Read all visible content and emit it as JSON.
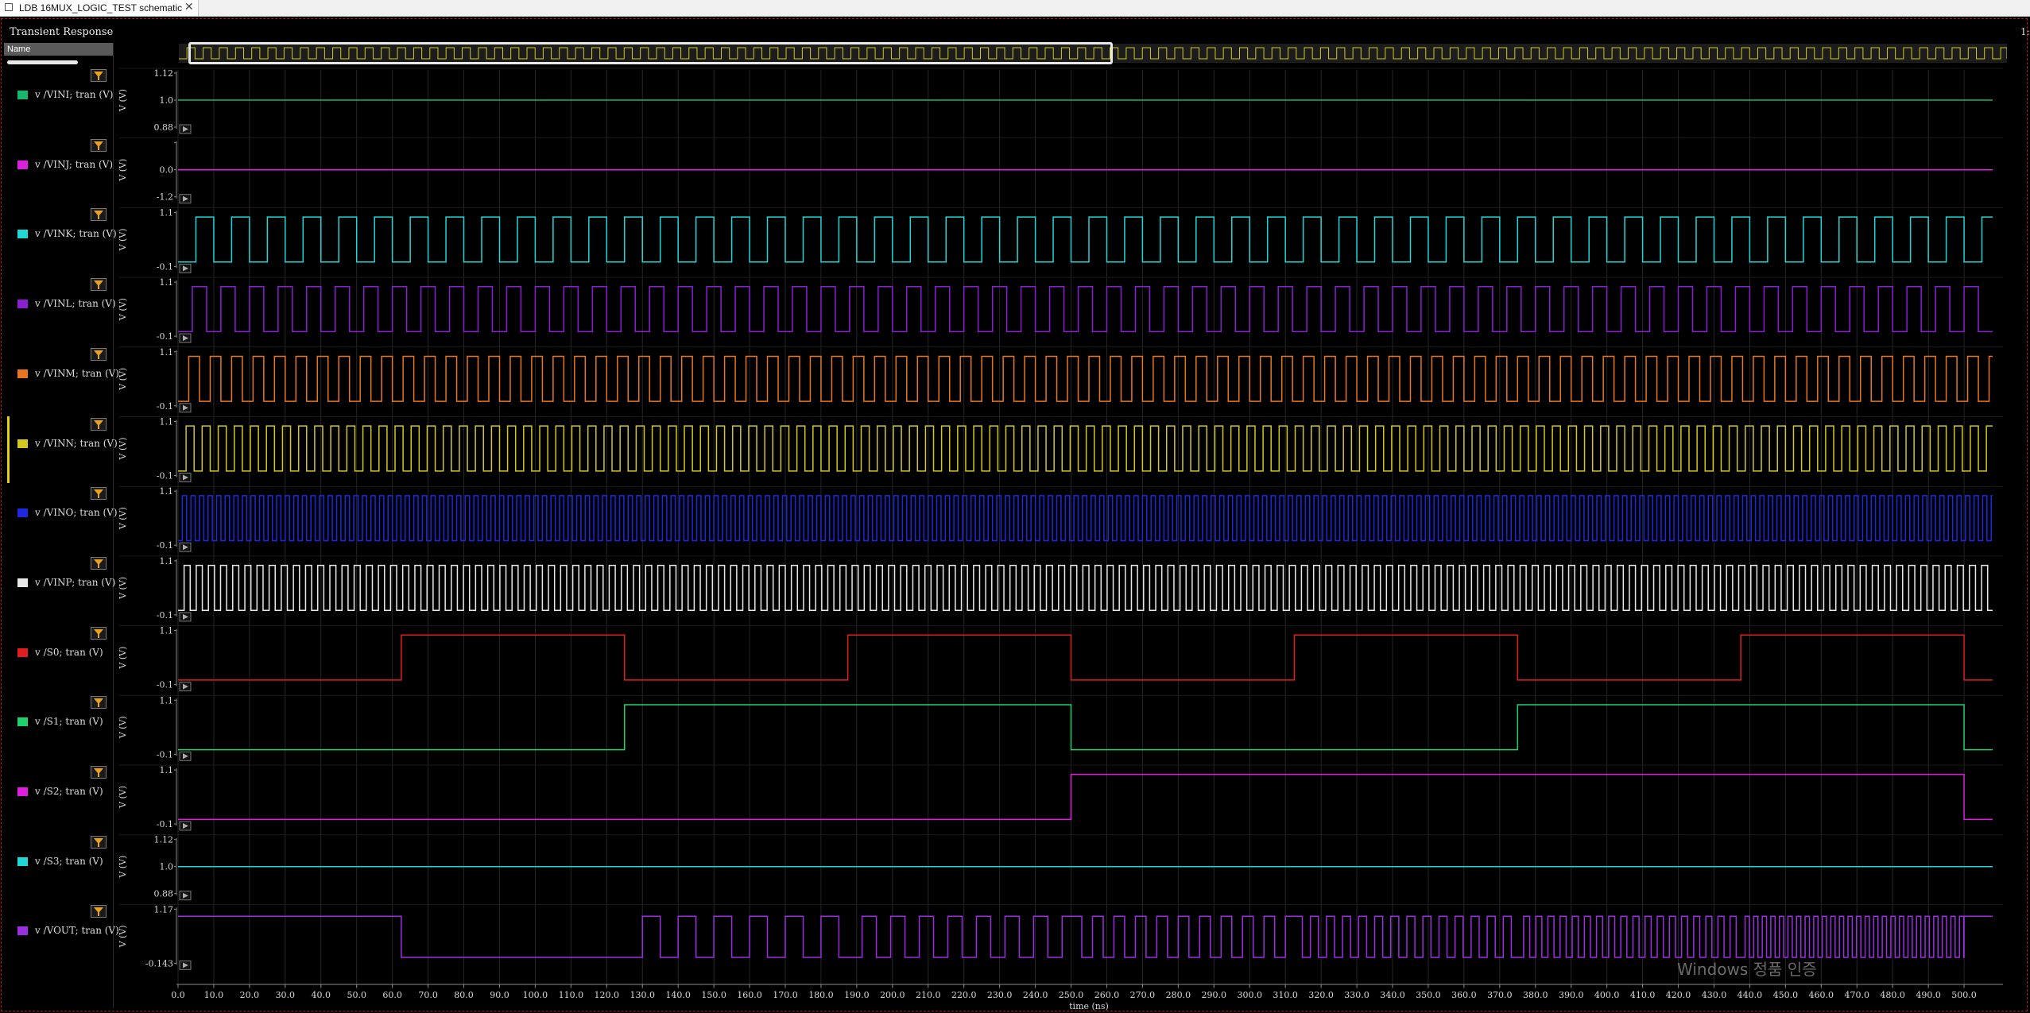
{
  "tab": {
    "title": "LDB 16MUX_LOGIC_TEST schematic",
    "close_glyph": "✕",
    "icon": "schematic-icon"
  },
  "panel": {
    "title": "Transient Response",
    "corner_label": "1:"
  },
  "sidebar": {
    "name_header": "Name"
  },
  "watermark": "Windows 정품 인증",
  "colors": {
    "grid": "#262626",
    "background": "#000000",
    "frame": "#b31717",
    "selected_marker": "#e6d200"
  },
  "chart_data": {
    "type": "line",
    "x_axis": {
      "label": "time (ns)",
      "range": [
        0,
        510
      ],
      "ticks": [
        "0.0",
        "10.0",
        "20.0",
        "30.0",
        "40.0",
        "50.0",
        "60.0",
        "70.0",
        "80.0",
        "90.0",
        "100.0",
        "110.0",
        "120.0",
        "130.0",
        "140.0",
        "150.0",
        "160.0",
        "170.0",
        "180.0",
        "190.0",
        "200.0",
        "210.0",
        "220.0",
        "230.0",
        "240.0",
        "250.0",
        "260.0",
        "270.0",
        "280.0",
        "290.0",
        "300.0",
        "310.0",
        "320.0",
        "330.0",
        "340.0",
        "350.0",
        "360.0",
        "370.0",
        "380.0",
        "390.0",
        "400.0",
        "410.0",
        "420.0",
        "430.0",
        "440.0",
        "450.0",
        "460.0",
        "470.0",
        "480.0",
        "490.0",
        "500.0"
      ]
    },
    "y_label": "V (V)",
    "grid": true,
    "legend": "left",
    "series": [
      {
        "name": "v /VINI; tran (V)",
        "color": "#14b86a",
        "kind": "const",
        "value": 1.0,
        "ylim": [
          0.88,
          1.12
        ],
        "ticks": [
          "1.12",
          "1.0",
          "0.88"
        ]
      },
      {
        "name": "v /VINJ; tran (V)",
        "color": "#e01ee0",
        "kind": "const",
        "value": 0.0,
        "ylim": [
          -1.2,
          1.2
        ],
        "ticks": [
          "",
          "0.0",
          "-1.2"
        ]
      },
      {
        "name": "v /VINK; tran (V)",
        "color": "#1ed8d8",
        "kind": "square",
        "period_ns": 10.0,
        "ylim": [
          -0.1,
          1.1
        ],
        "ticks": [
          "1.1",
          "-0.1"
        ]
      },
      {
        "name": "v /VINL; tran (V)",
        "color": "#8a1ed2",
        "kind": "square",
        "period_ns": 8.0,
        "ylim": [
          -0.1,
          1.1
        ],
        "ticks": [
          "1.1",
          "-0.1"
        ]
      },
      {
        "name": "v /VINM; tran (V)",
        "color": "#e8761e",
        "kind": "square",
        "period_ns": 6.0,
        "ylim": [
          -0.1,
          1.1
        ],
        "ticks": [
          "1.1",
          "-0.1"
        ]
      },
      {
        "name": "v /VINN; tran (V)",
        "color": "#d2c81e",
        "kind": "square",
        "period_ns": 4.5,
        "ylim": [
          -0.1,
          1.1
        ],
        "ticks": [
          "1.1",
          "-0.1"
        ]
      },
      {
        "name": "v /VINO; tran (V)",
        "color": "#1e28e0",
        "kind": "square",
        "period_ns": 2.4,
        "ylim": [
          -0.1,
          1.1
        ],
        "ticks": [
          "1.1",
          "-0.1"
        ]
      },
      {
        "name": "v /VINP; tran (V)",
        "color": "#e8e8e8",
        "kind": "square",
        "period_ns": 3.4,
        "ylim": [
          -0.1,
          1.1
        ],
        "ticks": [
          "1.1",
          "-0.1"
        ]
      },
      {
        "name": "v /S0; tran (V)",
        "color": "#e01e1e",
        "kind": "digital",
        "ylim": [
          -0.1,
          1.1
        ],
        "ticks": [
          "1.1",
          "-0.1"
        ],
        "points": [
          [
            0,
            0
          ],
          [
            62.5,
            0
          ],
          [
            62.5,
            1
          ],
          [
            125,
            1
          ],
          [
            125,
            0
          ],
          [
            187.5,
            0
          ],
          [
            187.5,
            1
          ],
          [
            250,
            1
          ],
          [
            250,
            0
          ],
          [
            312.5,
            0
          ],
          [
            312.5,
            1
          ],
          [
            375,
            1
          ],
          [
            375,
            0
          ],
          [
            437.5,
            0
          ],
          [
            437.5,
            1
          ],
          [
            500,
            1
          ],
          [
            500,
            0
          ],
          [
            508,
            0
          ]
        ]
      },
      {
        "name": "v /S1; tran (V)",
        "color": "#1ed26a",
        "kind": "digital",
        "ylim": [
          -0.1,
          1.1
        ],
        "ticks": [
          "1.1",
          "-0.1"
        ],
        "points": [
          [
            0,
            0
          ],
          [
            125,
            0
          ],
          [
            125,
            1
          ],
          [
            250,
            1
          ],
          [
            250,
            0
          ],
          [
            375,
            0
          ],
          [
            375,
            1
          ],
          [
            500,
            1
          ],
          [
            500,
            0
          ],
          [
            508,
            0
          ]
        ]
      },
      {
        "name": "v /S2; tran (V)",
        "color": "#e01ee0",
        "kind": "digital",
        "ylim": [
          -0.1,
          1.1
        ],
        "ticks": [
          "1.1",
          "-0.1"
        ],
        "points": [
          [
            0,
            0
          ],
          [
            250,
            0
          ],
          [
            250,
            1
          ],
          [
            500,
            1
          ],
          [
            500,
            0
          ],
          [
            508,
            0
          ]
        ]
      },
      {
        "name": "v /S3; tran (V)",
        "color": "#1ed8d8",
        "kind": "const",
        "value": 1.0,
        "ylim": [
          0.88,
          1.12
        ],
        "ticks": [
          "1.12",
          "1.0",
          "0.88"
        ]
      },
      {
        "name": "v /VOUT; tran (V)",
        "color": "#9a2ee0",
        "kind": "vout",
        "ylim": [
          -0.143,
          1.17
        ],
        "ticks": [
          "1.17",
          "-0.143"
        ],
        "segments": [
          [
            0,
            62.5,
            "high"
          ],
          [
            62.5,
            125,
            "low"
          ],
          [
            125,
            187.5,
            10.0
          ],
          [
            187.5,
            250,
            8.0
          ],
          [
            250,
            312.5,
            6.0
          ],
          [
            312.5,
            375,
            4.5
          ],
          [
            375,
            437.5,
            3.4
          ],
          [
            437.5,
            500,
            2.4
          ],
          [
            500,
            508,
            "high"
          ]
        ]
      }
    ]
  }
}
